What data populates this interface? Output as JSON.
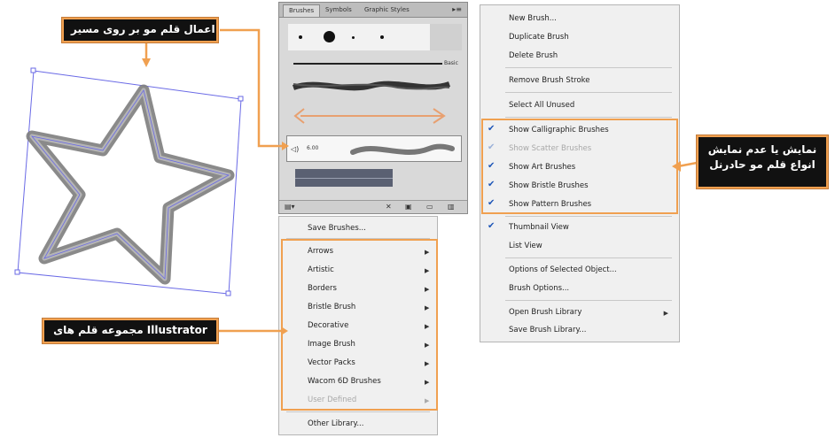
{
  "callouts": {
    "apply_brush": "اعمال قلم مو بر روی مسیر",
    "show_hide_line1": "نمایش یا عدم نمایش",
    "show_hide_line2": "انواع قلم مو حادرنل",
    "collection": "مجموعه قلم های Illustrator"
  },
  "brushes_panel": {
    "tabs": [
      "Brushes",
      "Symbols",
      "Graphic Styles"
    ],
    "basic_label": "Basic",
    "size_label": "6.00"
  },
  "flyout_menu": {
    "items": [
      {
        "label": "New Brush...",
        "checked": false,
        "disabled": false
      },
      {
        "label": "Duplicate Brush",
        "checked": false,
        "disabled": false
      },
      {
        "label": "Delete Brush",
        "checked": false,
        "disabled": false
      },
      {
        "label": "Remove Brush Stroke",
        "checked": false,
        "disabled": false
      },
      {
        "label": "Select All Unused",
        "checked": false,
        "disabled": false
      },
      {
        "label": "Show Calligraphic Brushes",
        "checked": true,
        "disabled": false
      },
      {
        "label": "Show Scatter Brushes",
        "checked": true,
        "disabled": true
      },
      {
        "label": "Show Art Brushes",
        "checked": true,
        "disabled": false
      },
      {
        "label": "Show Bristle Brushes",
        "checked": true,
        "disabled": false
      },
      {
        "label": "Show Pattern Brushes",
        "checked": true,
        "disabled": false
      },
      {
        "label": "Thumbnail View",
        "checked": true,
        "disabled": false
      },
      {
        "label": "List View",
        "checked": false,
        "disabled": false
      },
      {
        "label": "Options of Selected Object...",
        "checked": false,
        "disabled": false
      },
      {
        "label": "Brush Options...",
        "checked": false,
        "disabled": false
      },
      {
        "label": "Open Brush Library",
        "checked": false,
        "disabled": false,
        "submenu": true
      },
      {
        "label": "Save Brush Library...",
        "checked": false,
        "disabled": false
      }
    ]
  },
  "library_menu": {
    "items": [
      {
        "label": "Save Brushes...",
        "submenu": false,
        "disabled": false
      },
      {
        "label": "Arrows",
        "submenu": true,
        "disabled": false
      },
      {
        "label": "Artistic",
        "submenu": true,
        "disabled": false
      },
      {
        "label": "Borders",
        "submenu": true,
        "disabled": false
      },
      {
        "label": "Bristle Brush",
        "submenu": true,
        "disabled": false
      },
      {
        "label": "Decorative",
        "submenu": true,
        "disabled": false
      },
      {
        "label": "Image Brush",
        "submenu": true,
        "disabled": false
      },
      {
        "label": "Vector Packs",
        "submenu": true,
        "disabled": false
      },
      {
        "label": "Wacom 6D Brushes",
        "submenu": true,
        "disabled": false
      },
      {
        "label": "User Defined",
        "submenu": true,
        "disabled": true
      },
      {
        "label": "Other Library...",
        "submenu": false,
        "disabled": false
      }
    ]
  },
  "colors": {
    "accent_orange": "#f0a050",
    "check_blue": "#1e56b8",
    "selection_blue": "#6a6ae6"
  },
  "icons": [
    "chevron-right-icon",
    "checkmark-icon",
    "panel-menu-icon",
    "new-brush-icon",
    "delete-brush-icon",
    "brush-library-icon",
    "star-artwork"
  ]
}
